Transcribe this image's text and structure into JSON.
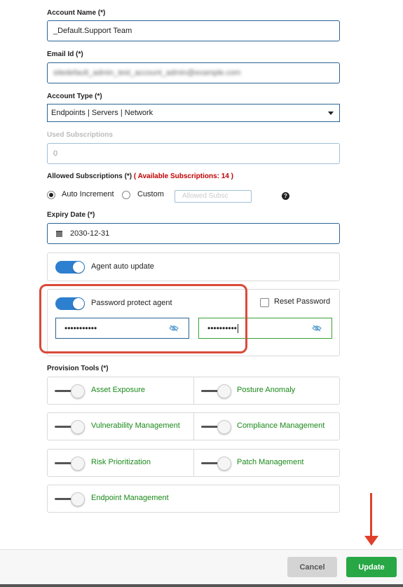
{
  "account_name": {
    "label": "Account Name (*)",
    "value": "_Default.Support Team"
  },
  "email": {
    "label": "Email Id (*)",
    "value": "sitedefault_admin_test_account_admin@example.com"
  },
  "account_type": {
    "label": "Account Type (*)",
    "value": "Endpoints | Servers | Network"
  },
  "used_subscriptions": {
    "label": "Used Subscriptions",
    "value": "0"
  },
  "allowed_subscriptions": {
    "label": "Allowed Subscriptions (*)",
    "available": "( Available Subscriptions: 14 )",
    "options": [
      "Auto Increment",
      "Custom"
    ],
    "selected": "Auto Increment",
    "placeholder": "Allowed Subsc",
    "help": "?"
  },
  "expiry_date": {
    "label": "Expiry Date (*)",
    "value": "2030-12-31"
  },
  "agent_auto_update": {
    "label": "Agent auto update",
    "enabled": true
  },
  "password_protect": {
    "label": "Password protect agent",
    "enabled": true,
    "reset_label": "Reset Password",
    "reset_checked": false,
    "password": "•••••••••••",
    "confirm_password": "••••••••••"
  },
  "provision_tools": {
    "label": "Provision Tools (*)",
    "items": [
      {
        "label": "Asset Exposure",
        "enabled": false
      },
      {
        "label": "Posture Anomaly",
        "enabled": false
      },
      {
        "label": "Vulnerability Management",
        "enabled": false
      },
      {
        "label": "Compliance Management",
        "enabled": false
      },
      {
        "label": "Risk Prioritization",
        "enabled": false
      },
      {
        "label": "Patch Management",
        "enabled": false
      },
      {
        "label": "Endpoint Management",
        "enabled": false
      }
    ]
  },
  "footer": {
    "cancel": "Cancel",
    "update": "Update"
  },
  "colors": {
    "primary": "#2d7fd0",
    "success": "#28a745",
    "annotation": "#d94a3a",
    "tool_label": "#1a8a1a",
    "available": "#c00000"
  }
}
